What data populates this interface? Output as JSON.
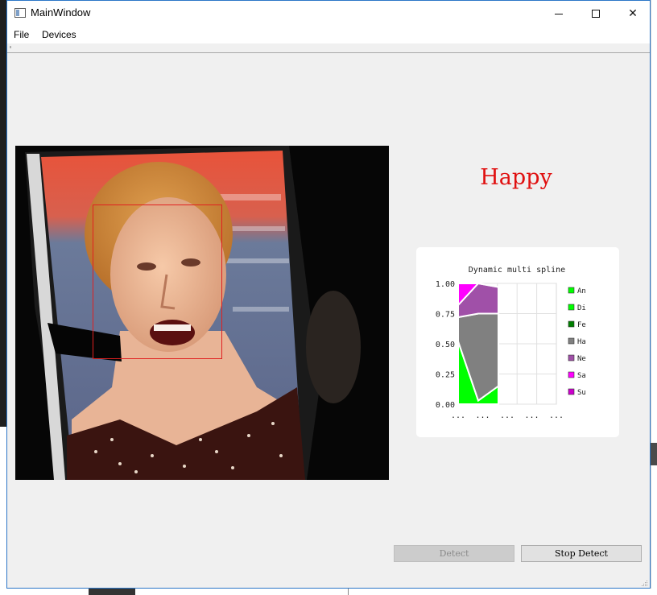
{
  "window": {
    "title": "MainWindow",
    "controls": {
      "minimize": "minimize",
      "maximize": "maximize",
      "close": "✕"
    }
  },
  "menu": {
    "file": "File",
    "devices": "Devices"
  },
  "camera": {
    "description_icon": "webcam-frame"
  },
  "emotion": {
    "label": "Happy",
    "color": "#e01010"
  },
  "buttons": {
    "detect": "Detect",
    "stop_detect": "Stop Detect"
  },
  "chart_data": {
    "type": "area",
    "title": "Dynamic multi spline",
    "stacked": true,
    "x": [
      0,
      1,
      2
    ],
    "x_tick_labels": [
      "...",
      "...",
      "...",
      "...",
      "..."
    ],
    "ylim": [
      0,
      1
    ],
    "y_ticks": [
      "1.00",
      "0.75",
      "0.50",
      "0.25",
      "0.00"
    ],
    "grid": true,
    "legend_position": "right",
    "series": [
      {
        "name": "An",
        "values": [
          0.0,
          0.0,
          0.0
        ],
        "color": "#00ff00"
      },
      {
        "name": "Di",
        "values": [
          0.52,
          0.03,
          0.15
        ],
        "color": "#00ff00"
      },
      {
        "name": "Fe",
        "values": [
          0.0,
          0.0,
          0.0
        ],
        "color": "#008000"
      },
      {
        "name": "Ha",
        "values": [
          0.2,
          0.72,
          0.6
        ],
        "color": "#808080"
      },
      {
        "name": "Ne",
        "values": [
          0.1,
          0.25,
          0.22
        ],
        "color": "#a050a8"
      },
      {
        "name": "Sa",
        "values": [
          0.18,
          0.0,
          0.0
        ],
        "color": "#ff00ff"
      },
      {
        "name": "Su",
        "values": [
          0.0,
          0.0,
          0.0
        ],
        "color": "#cc00cc"
      }
    ]
  }
}
